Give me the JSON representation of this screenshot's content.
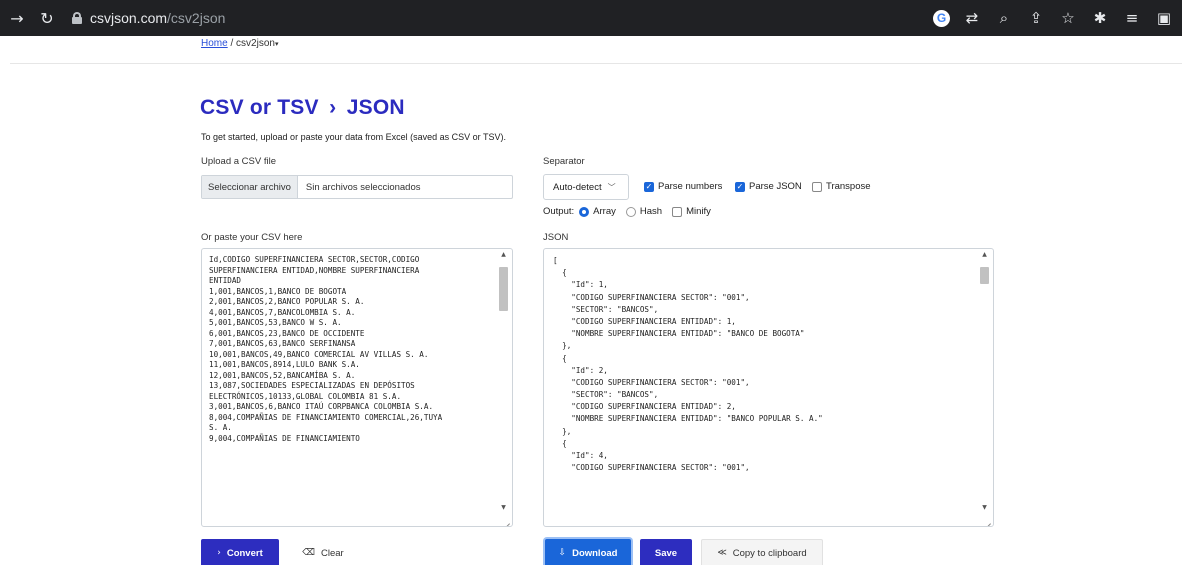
{
  "browser": {
    "url_host": "csvjson.com",
    "url_path": "/csv2json"
  },
  "breadcrumb": {
    "home": "Home",
    "separator": "/",
    "current": "csv2json"
  },
  "page": {
    "title": "CSV or TSV  ›  JSON",
    "subtitle": "To get started, upload or paste your data from Excel (saved as CSV or TSV)."
  },
  "upload": {
    "label": "Upload a CSV file",
    "button_label": "Seleccionar archivo",
    "status": "Sin archivos seleccionados"
  },
  "separator": {
    "label": "Separator",
    "selected": "Auto-detect",
    "parse_numbers": "Parse numbers",
    "parse_json": "Parse JSON",
    "transpose": "Transpose",
    "output_label": "Output:",
    "array": "Array",
    "hash": "Hash",
    "minify": "Minify"
  },
  "csv": {
    "label": "Or paste your CSV here",
    "lines": [
      "Id,CODIGO SUPERFINANCIERA SECTOR,SECTOR,CODIGO",
      "SUPERFINANCIERA ENTIDAD,NOMBRE SUPERFINANCIERA",
      "ENTIDAD",
      "1,001,BANCOS,1,BANCO DE BOGOTA",
      "2,001,BANCOS,2,BANCO POPULAR S. A.",
      "4,001,BANCOS,7,BANCOLOMBIA S. A.",
      "5,001,BANCOS,53,BANCO W S. A.",
      "6,001,BANCOS,23,BANCO DE OCCIDENTE",
      "7,001,BANCOS,63,BANCO SERFINANSA",
      "10,001,BANCOS,49,BANCO COMERCIAL AV VILLAS S. A.",
      "11,001,BANCOS,8914,LULO BANK S.A.",
      "12,001,BANCOS,52,BANCAMÍBA S. A.",
      "13,087,SOCIEDADES ESPECIALIZADAS EN DEPÓSITOS",
      "ELECTRÓNICOS,10133,GLOBAL COLOMBIA 81 S.A.",
      "3,001,BANCOS,6,BANCO ITAÚ CORPBANCA COLOMBIA S.A.",
      "8,004,COMPAÑIAS DE FINANCIAMIENTO COMERCIAL,26,TUYA",
      "S. A.",
      "9,004,COMPAÑIAS DE FINANCIAMIENTO"
    ]
  },
  "json": {
    "label": "JSON",
    "lines": [
      "[",
      "  {",
      "    \"Id\": 1,",
      "    \"CODIGO SUPERFINANCIERA SECTOR\": \"001\",",
      "    \"SECTOR\": \"BANCOS\",",
      "    \"CODIGO SUPERFINANCIERA ENTIDAD\": 1,",
      "    \"NOMBRE SUPERFINANCIERA ENTIDAD\": \"BANCO DE BOGOTA\"",
      "  },",
      "  {",
      "    \"Id\": 2,",
      "    \"CODIGO SUPERFINANCIERA SECTOR\": \"001\",",
      "    \"SECTOR\": \"BANCOS\",",
      "    \"CODIGO SUPERFINANCIERA ENTIDAD\": 2,",
      "    \"NOMBRE SUPERFINANCIERA ENTIDAD\": \"BANCO POPULAR S. A.\"",
      "  },",
      "  {",
      "    \"Id\": 4,",
      "    \"CODIGO SUPERFINANCIERA SECTOR\": \"001\","
    ]
  },
  "actions": {
    "convert": "Convert",
    "clear": "Clear",
    "download": "Download",
    "save": "Save",
    "copy": "Copy to clipboard"
  }
}
